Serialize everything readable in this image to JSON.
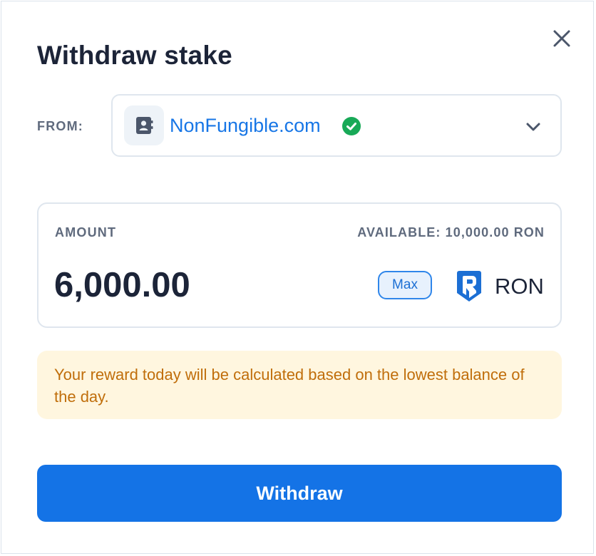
{
  "dialog": {
    "title": "Withdraw stake",
    "close_icon": "close-icon"
  },
  "from": {
    "label": "FROM:",
    "selected_name": "NonFungible.com",
    "avatar_icon": "contact-card-icon",
    "verified_icon": "verified-check-icon",
    "dropdown_icon": "chevron-down-icon"
  },
  "amount": {
    "label": "AMOUNT",
    "available": "AVAILABLE: 10,000.00 RON",
    "value": "6,000.00",
    "max_label": "Max",
    "token_icon": "ronin-token-icon",
    "token": "RON"
  },
  "notice": {
    "text": "Your reward today will be calculated based on the lowest balance of the day."
  },
  "actions": {
    "withdraw_label": "Withdraw"
  },
  "colors": {
    "primary": "#1473e6",
    "verified": "#18a957",
    "notice_bg": "#fff6df",
    "notice_text": "#c06e0b"
  }
}
